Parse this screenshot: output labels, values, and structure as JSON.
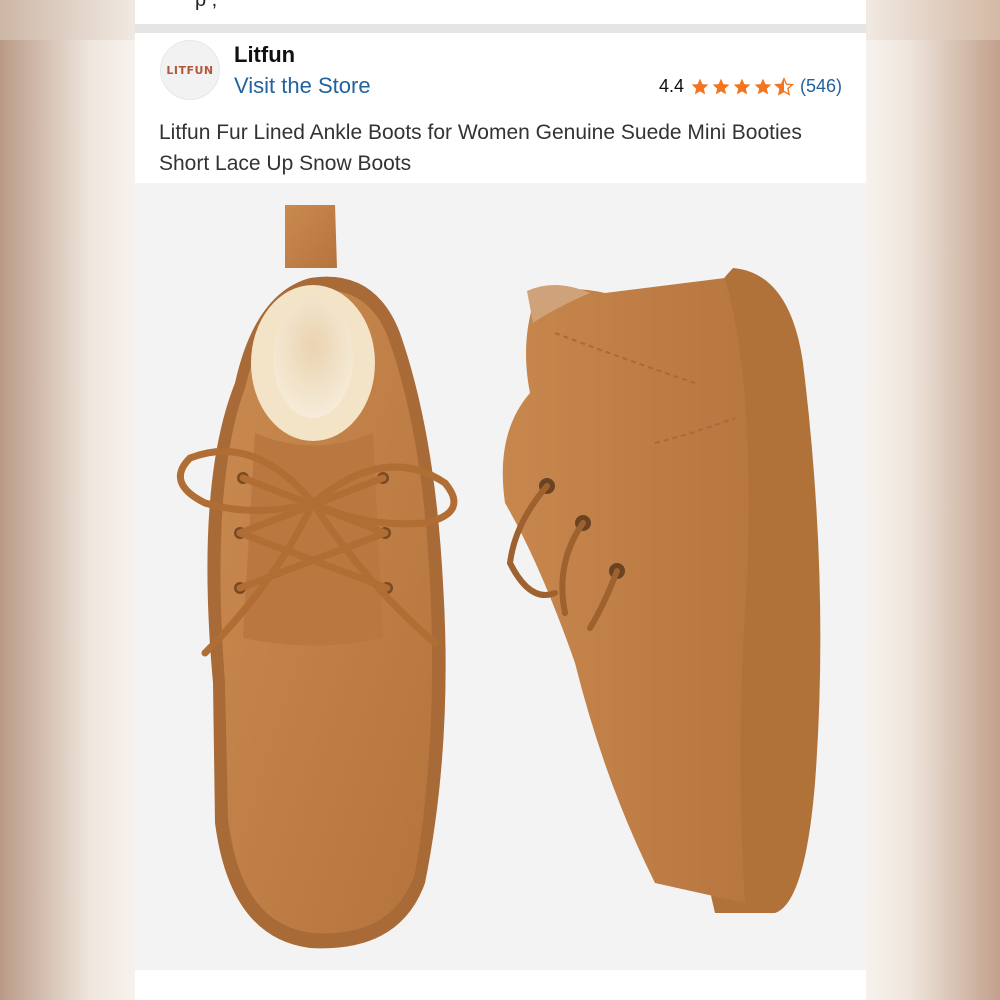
{
  "top_partial_text": "p                               ,",
  "store": {
    "logo_text": "LITFUN",
    "brand_name": "Litfun",
    "visit_link": "Visit the Store"
  },
  "rating": {
    "value": "4.4",
    "stars": 4.4,
    "count": "(546)",
    "star_color": "#f3751e"
  },
  "product": {
    "title": "Litfun Fur Lined Ankle Boots for Women Genuine Suede Mini Booties Short Lace Up Snow Boots"
  },
  "colors": {
    "link": "#2162a1",
    "suede": "#bf7e45",
    "background": "#f3f3f3"
  }
}
